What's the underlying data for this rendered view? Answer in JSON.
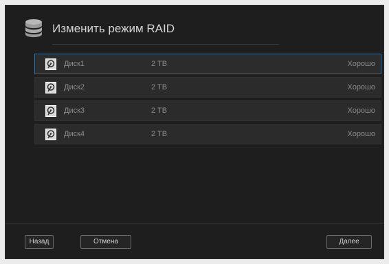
{
  "dialog": {
    "title": "Изменить режим RAID",
    "icon": "database-icon"
  },
  "disks": [
    {
      "name": "Диск1",
      "size": "2 TB",
      "status": "Хорошо",
      "selected": true
    },
    {
      "name": "Диск2",
      "size": "2 TB",
      "status": "Хорошо",
      "selected": false
    },
    {
      "name": "Диск3",
      "size": "2 TB",
      "status": "Хорошо",
      "selected": false
    },
    {
      "name": "Диск4",
      "size": "2 TB",
      "status": "Хорошо",
      "selected": false
    }
  ],
  "buttons": {
    "back_label": "Назад",
    "cancel_label": "Отмена",
    "next_label": "Далее"
  },
  "colors": {
    "background": "#1e1e1e",
    "row": "#2b2b2b",
    "selected_border": "#3f6c8f",
    "text": "#8c8c8c"
  }
}
